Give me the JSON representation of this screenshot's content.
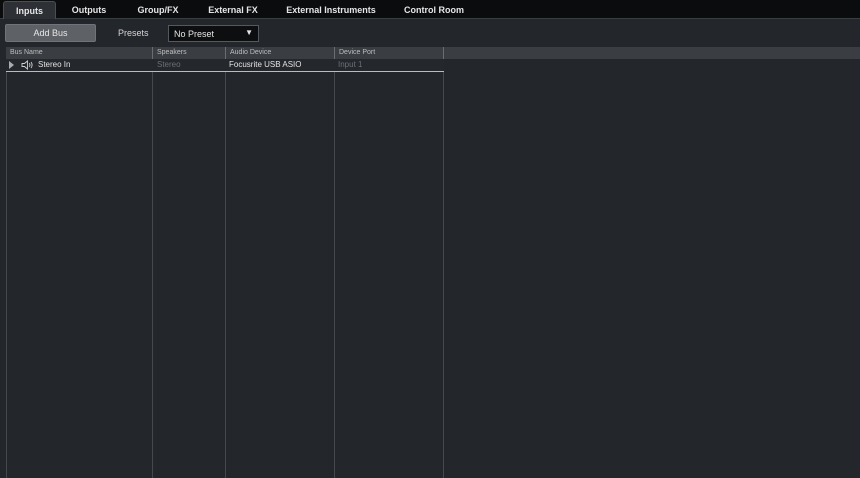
{
  "tabs": [
    {
      "label": "Inputs",
      "active": true
    },
    {
      "label": "Outputs",
      "active": false
    },
    {
      "label": "Group/FX",
      "active": false
    },
    {
      "label": "External FX",
      "active": false
    },
    {
      "label": "External Instruments",
      "active": false
    },
    {
      "label": "Control Room",
      "active": false
    }
  ],
  "toolbar": {
    "add_bus_label": "Add Bus",
    "presets_label": "Presets",
    "preset_value": "No Preset"
  },
  "table": {
    "columns": [
      "Bus Name",
      "Speakers",
      "Audio Device",
      "Device Port"
    ],
    "rows": [
      {
        "bus_name": "Stereo In",
        "speakers": "Stereo",
        "audio_device": "Focusrite USB ASIO",
        "device_port": "Input 1",
        "icon": "speaker-icon"
      }
    ]
  },
  "colors": {
    "tabbar_bg": "#0b0c0e",
    "panel_bg": "#23262b",
    "header_bg": "#3a3d42",
    "button_bg": "#5e6166"
  }
}
